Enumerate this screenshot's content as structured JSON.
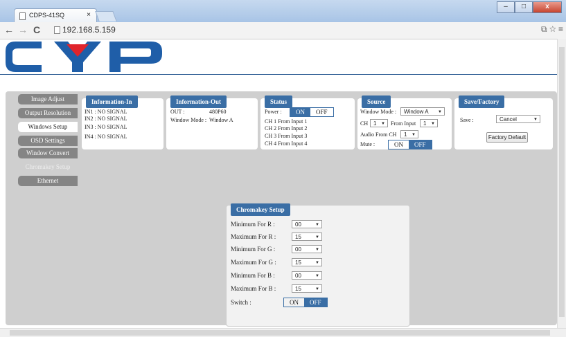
{
  "browser": {
    "tab_title": "CDPS-41SQ",
    "tab_close": "×",
    "url": "192.168.5.159",
    "win_min": "–",
    "win_max": "□",
    "win_close": "x"
  },
  "logo_text": "CYP",
  "sidebar": {
    "items": [
      {
        "label": "Image Adjust"
      },
      {
        "label": "Output Resolution"
      },
      {
        "label": "Windows Setup"
      },
      {
        "label": "OSD Settings"
      },
      {
        "label": "Window Convert"
      },
      {
        "label": "Chromakey Setup"
      },
      {
        "label": "Ethernet"
      }
    ],
    "active": "Windows Setup"
  },
  "info_in": {
    "title": "Information-In",
    "lines": [
      "IN1 : NO SIGNAL",
      "IN2 : NO SIGNAL",
      "IN3 : NO SIGNAL",
      "IN4 : NO SIGNAL"
    ]
  },
  "info_out": {
    "title": "Information-Out",
    "out_label": "OUT :",
    "out_value": "480P60",
    "mode_label": "Window Mode :",
    "mode_value": "Window A"
  },
  "status": {
    "title": "Status",
    "power_label": "Power :",
    "on": "ON",
    "off": "OFF",
    "channels": [
      "CH 1 From Input  1",
      "CH 2 From Input  2",
      "CH 3 From Input  3",
      "CH 4 From Input  4"
    ]
  },
  "source": {
    "title": "Source",
    "window_mode_label": "Window Mode :",
    "window_mode_value": "Window A",
    "ch_label": "CH",
    "ch_value": "1",
    "from_input_label": "From Input",
    "from_input_value": "1",
    "audio_label": "Audio From CH",
    "audio_value": "1",
    "mute_label": "Mute :",
    "on": "ON",
    "off": "OFF"
  },
  "save_factory": {
    "title": "Save/Factory",
    "save_label": "Save :",
    "save_value": "Cancel",
    "factory_button": "Factory Default"
  },
  "chromakey": {
    "title": "Chromakey Setup",
    "rows": [
      {
        "label": "Minimum For R :",
        "value": "00"
      },
      {
        "label": "Maximum For R :",
        "value": "15"
      },
      {
        "label": "Minimum For G :",
        "value": "00"
      },
      {
        "label": "Maximum For G :",
        "value": "15"
      },
      {
        "label": "Minimum For B :",
        "value": "00"
      },
      {
        "label": "Maximum For B :",
        "value": "15"
      }
    ],
    "switch_label": "Switch :",
    "on": "ON",
    "off": "OFF"
  },
  "colors": {
    "accent": "#3a6ea5",
    "logo_blue": "#1f5ea8",
    "logo_red": "#e0242b"
  }
}
